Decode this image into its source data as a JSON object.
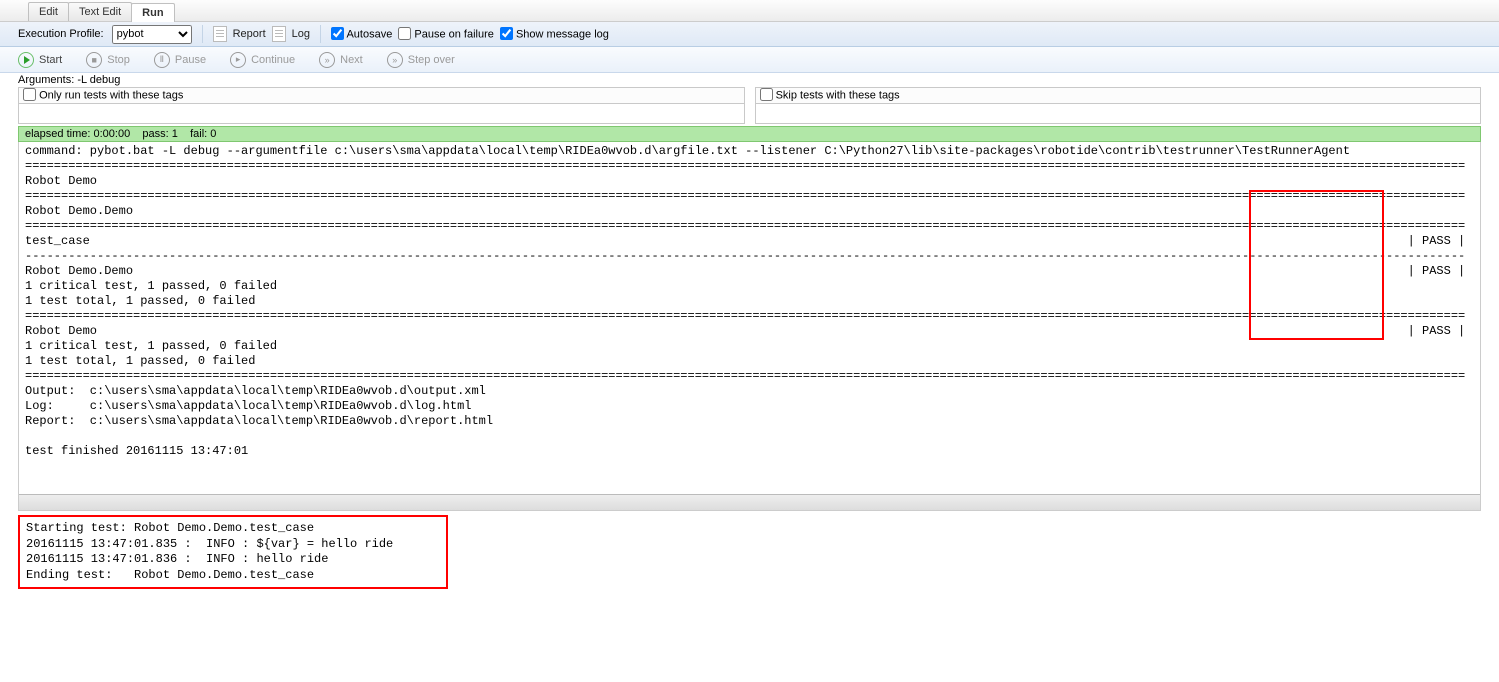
{
  "tabs": {
    "edit": "Edit",
    "textedit": "Text Edit",
    "run": "Run"
  },
  "profile": {
    "label": "Execution Profile:",
    "value": "pybot"
  },
  "toolbar": {
    "report": "Report",
    "log": "Log",
    "autosave": "Autosave",
    "pause_on_failure": "Pause on failure",
    "show_message_log": "Show message log",
    "start": "Start",
    "stop": "Stop",
    "pause": "Pause",
    "cont": "Continue",
    "next": "Next",
    "stepover": "Step over"
  },
  "arguments": {
    "label": "Arguments:",
    "value": "-L debug"
  },
  "tagfilters": {
    "only": "Only run tests with these tags",
    "skip": "Skip tests with these tags"
  },
  "status": {
    "elapsed": "elapsed time: 0:00:00",
    "pass": "pass: 1",
    "fail": "fail: 0"
  },
  "console": [
    "command: pybot.bat -L debug --argumentfile c:\\users\\sma\\appdata\\local\\temp\\RIDEa0wvob.d\\argfile.txt --listener C:\\Python27\\lib\\site-packages\\robotide\\contrib\\testrunner\\TestRunnerAgent",
    "========================================================================================================================================================================================================",
    "Robot Demo                                                                                                                                                                                              ",
    "========================================================================================================================================================================================================",
    "Robot Demo.Demo                                                                                                                                                                                         ",
    "========================================================================================================================================================================================================",
    "test_case                                                                                                                                                                                       | PASS |",
    "--------------------------------------------------------------------------------------------------------------------------------------------------------------------------------------------------------",
    "Robot Demo.Demo                                                                                                                                                                                 | PASS |",
    "1 critical test, 1 passed, 0 failed",
    "1 test total, 1 passed, 0 failed",
    "========================================================================================================================================================================================================",
    "Robot Demo                                                                                                                                                                                      | PASS |",
    "1 critical test, 1 passed, 0 failed",
    "1 test total, 1 passed, 0 failed",
    "========================================================================================================================================================================================================",
    "Output:  c:\\users\\sma\\appdata\\local\\temp\\RIDEa0wvob.d\\output.xml",
    "Log:     c:\\users\\sma\\appdata\\local\\temp\\RIDEa0wvob.d\\log.html",
    "Report:  c:\\users\\sma\\appdata\\local\\temp\\RIDEa0wvob.d\\report.html",
    "",
    "test finished 20161115 13:47:01"
  ],
  "msglog": [
    "Starting test: Robot Demo.Demo.test_case",
    "20161115 13:47:01.835 :  INFO : ${var} = hello ride",
    "20161115 13:47:01.836 :  INFO : hello ride",
    "Ending test:   Robot Demo.Demo.test_case"
  ]
}
